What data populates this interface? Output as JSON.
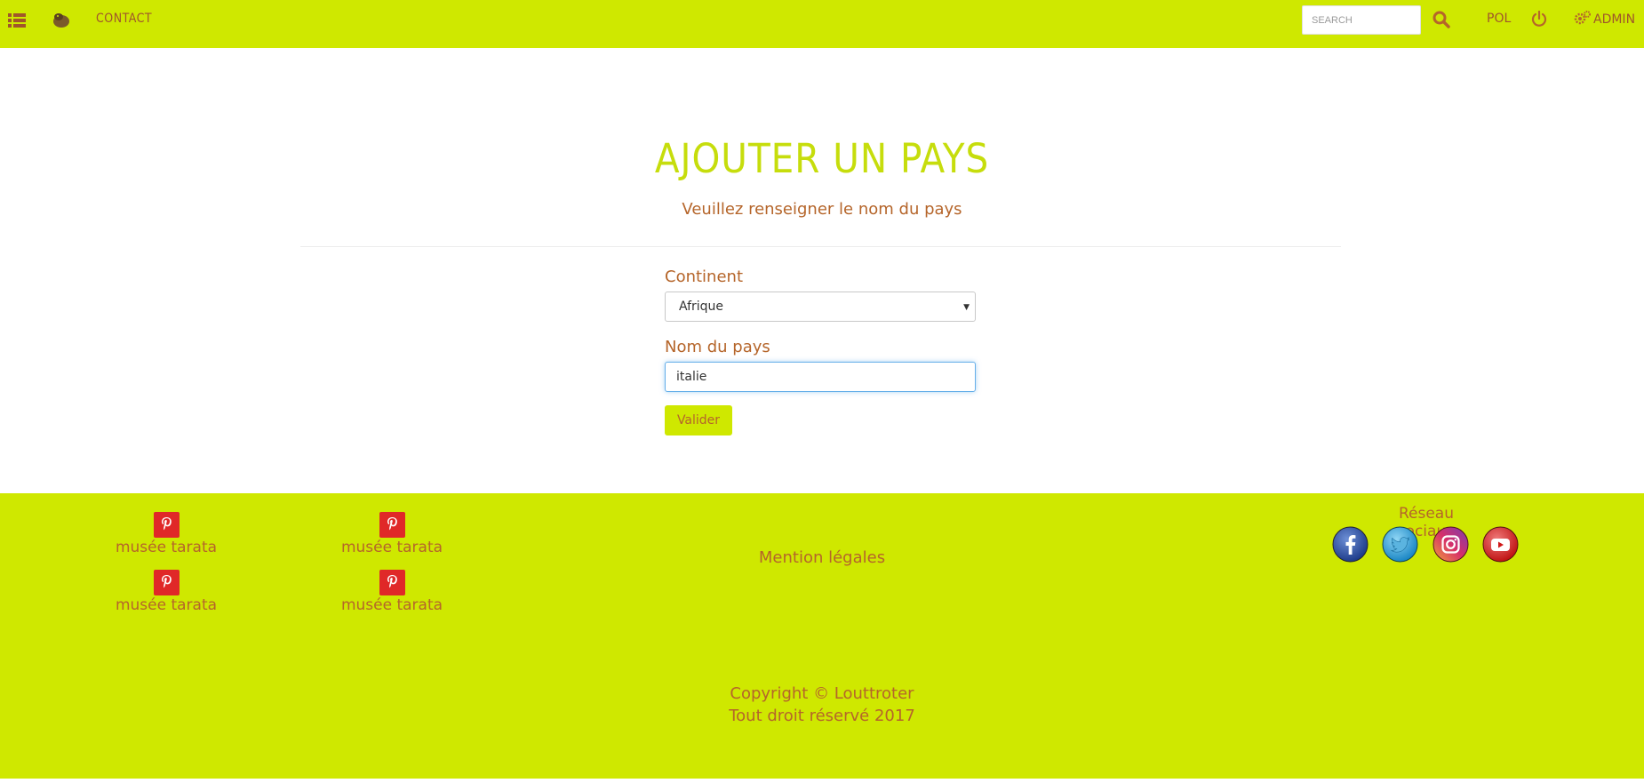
{
  "header": {
    "menu_icon": "list-icon",
    "logo_icon": "otter-logo-icon",
    "contact_label": "CONTACT",
    "search_placeholder": "SEARCH",
    "search_icon": "search-icon",
    "language_label": "POL",
    "power_icon": "power-icon",
    "admin_label": "ADMIN",
    "admin_icon": "gears-icon",
    "bar_color": "#cfe800"
  },
  "main": {
    "title": "AJOUTER UN PAYS",
    "subtitle": "Veuillez renseigner le nom du pays",
    "continent_label": "Continent",
    "continent_selected": "Afrique",
    "country_label": "Nom du pays",
    "country_value": "italie",
    "submit_label": "Valider"
  },
  "footer": {
    "pinterest_links": [
      {
        "label": "musée tarata",
        "icon": "pinterest-icon"
      },
      {
        "label": "musée tarata",
        "icon": "pinterest-icon"
      },
      {
        "label": "musée tarata",
        "icon": "pinterest-icon"
      },
      {
        "label": "musée tarata",
        "icon": "pinterest-icon"
      }
    ],
    "mention_label": "Mention légales",
    "social_title": "Réseau sociaux",
    "social_icons": [
      "facebook-icon",
      "twitter-icon",
      "instagram-icon",
      "youtube-icon"
    ],
    "copyright_line1": "Copyright © Louttroter",
    "copyright_line2": "Tout droit réservé 2017"
  }
}
